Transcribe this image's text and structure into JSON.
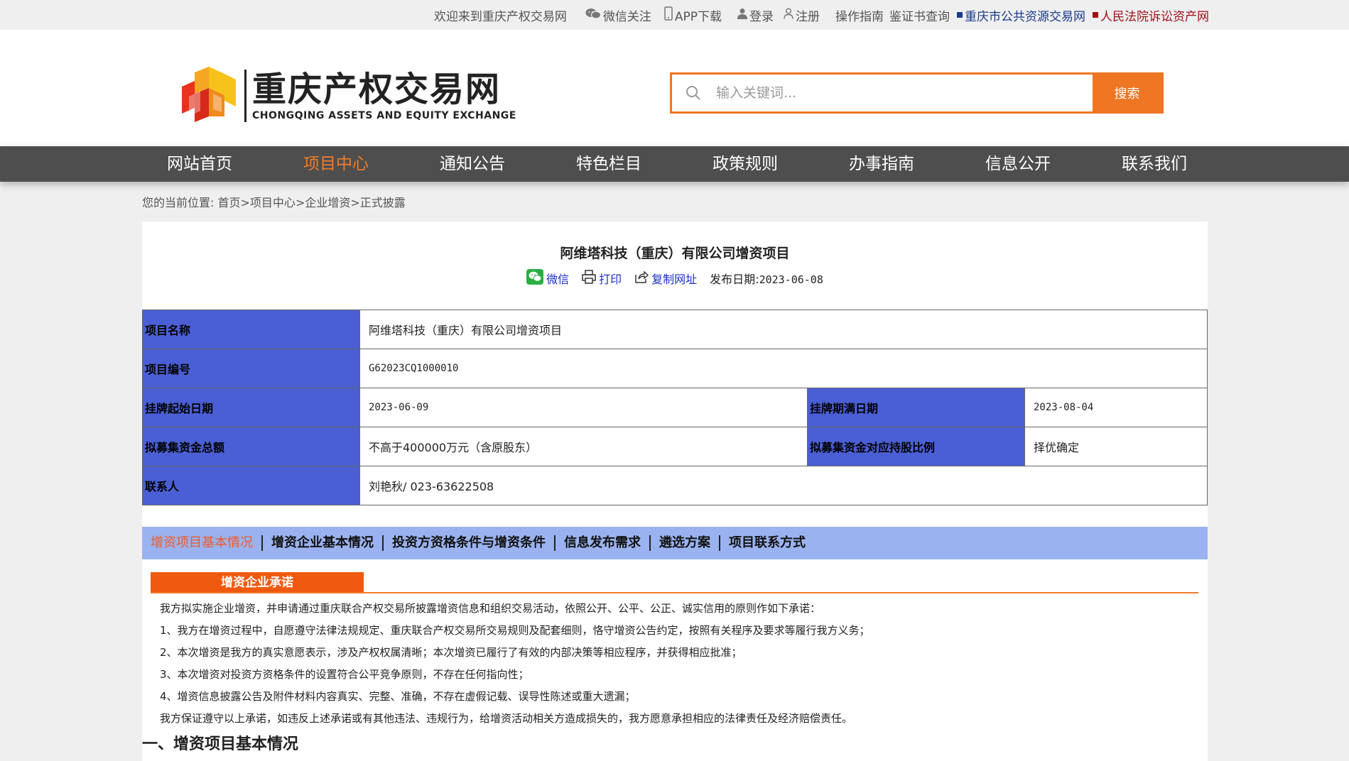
{
  "topbar": {
    "welcome": "欢迎来到重庆产权交易网",
    "wechat": "微信关注",
    "app": "APP下载",
    "login": "登录",
    "register": "注册",
    "guide": "操作指南",
    "cert_query": "鉴证书查询",
    "public_resource": "重庆市公共资源交易网",
    "court_assets": "人民法院诉讼资产网"
  },
  "logo": {
    "cn": "重庆产权交易网",
    "en": "CHONGQING ASSETS AND EQUITY EXCHANGE"
  },
  "search": {
    "placeholder": "输入关键词...",
    "button": "搜索"
  },
  "nav": {
    "items": [
      "网站首页",
      "项目中心",
      "通知公告",
      "特色栏目",
      "政策规则",
      "办事指南",
      "信息公开",
      "联系我们"
    ],
    "active_index": 1
  },
  "breadcrumb": {
    "prefix": "您的当前位置:",
    "items": [
      "首页",
      "项目中心",
      "企业增资",
      "正式披露"
    ],
    "sep": ">"
  },
  "project": {
    "title": "阿维塔科技（重庆）有限公司增资项目",
    "share_wechat": "微信",
    "print": "打印",
    "copy_url": "复制网址",
    "publish_label": "发布日期:",
    "publish_date": "2023-06-08"
  },
  "info": {
    "name_label": "项目名称",
    "name_value": "阿维塔科技（重庆）有限公司增资项目",
    "code_label": "项目编号",
    "code_value": "G62023CQ1000010",
    "start_label": "挂牌起始日期",
    "start_value": "2023-06-09",
    "end_label": "挂牌期满日期",
    "end_value": "2023-08-04",
    "amount_label": "拟募集资金总额",
    "amount_value": "不高于400000万元（含原股东）",
    "ratio_label": "拟募集资金对应持股比例",
    "ratio_value": "择优确定",
    "contact_label": "联系人",
    "contact_value": "刘艳秋/ 023-63622508"
  },
  "tabs": {
    "items": [
      "增资项目基本情况",
      "增资企业基本情况",
      "投资方资格条件与增资条件",
      "信息发布需求",
      "遴选方案",
      "项目联系方式"
    ],
    "active_index": 0
  },
  "commitment": {
    "title": "增资企业承诺",
    "lines": [
      "我方拟实施企业增资，并申请通过重庆联合产权交易所披露增资信息和组织交易活动，依照公开、公平、公正、诚实信用的原则作如下承诺：",
      "1、我方在增资过程中，自愿遵守法律法规规定、重庆联合产权交易所交易规则及配套细则，恪守增资公告约定，按照有关程序及要求等履行我方义务；",
      "2、本次增资是我方的真实意愿表示，涉及产权权属清晰；本次增资已履行了有效的内部决策等相应程序，并获得相应批准；",
      "3、本次增资对投资方资格条件的设置符合公平竞争原则，不存在任何指向性；",
      "4、增资信息披露公告及附件材料内容真实、完整、准确，不存在虚假记载、误导性陈述或重大遗漏；",
      "我方保证遵守以上承诺，如违反上述承诺或有其他违法、违规行为，给增资活动相关方造成损失的，我方愿意承担相应的法律责任及经济赔偿责任。"
    ]
  },
  "section1": "一、增资项目基本情况",
  "colors": {
    "accent_orange": "#ef7622",
    "nav_bg": "#4e4e4e",
    "table_header_bg": "#4a5fd4",
    "tab_bar_bg": "#9ab2ef",
    "link_blue": "#1a2fd0"
  }
}
